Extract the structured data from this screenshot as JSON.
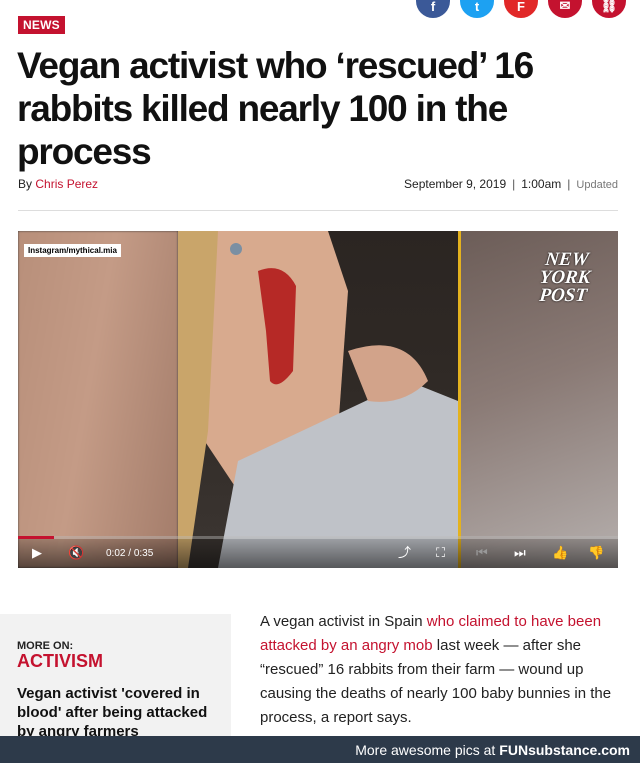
{
  "section_tag": "NEWS",
  "share_icons": [
    {
      "name": "facebook-icon",
      "glyph": "f",
      "color": "#3b5998"
    },
    {
      "name": "twitter-icon",
      "glyph": "t",
      "color": "#1da1f2"
    },
    {
      "name": "flipboard-icon",
      "glyph": "F",
      "color": "#e12828"
    },
    {
      "name": "email-icon",
      "glyph": "✉",
      "color": "#c4122f"
    },
    {
      "name": "link-icon",
      "glyph": "⛓",
      "color": "#c4122f"
    }
  ],
  "headline": "Vegan activist who ‘rescued’ 16 rabbits killed nearly 100 in the process",
  "byline": {
    "prefix": "By",
    "author": "Chris Perez"
  },
  "dateline": {
    "date": "September 9, 2019",
    "time": "1:00am",
    "updated": "Updated"
  },
  "video": {
    "watermark": "Instagram/mythical.mia",
    "logo_lines": [
      "NEW",
      "YORK",
      "POST"
    ],
    "current_time": "0:02",
    "duration": "0:35",
    "progress_pct": 6
  },
  "more_on": {
    "label": "MORE ON:",
    "topic": "ACTIVISM",
    "related_title": "Vegan activist 'covered in blood' after being attacked by angry farmers"
  },
  "article": {
    "p1_start": "A vegan activist in Spain ",
    "p1_link": "who claimed to have been attacked by an angry mob",
    "p1_end": " last week — after she “rescued” 16 rabbits from their farm — wound up causing the deaths of nearly 100 baby bunnies in the process, a report says."
  },
  "footer": {
    "text": "More awesome pics at",
    "brand": "FUNsubstance.com"
  },
  "colors": {
    "accent": "#c4122f",
    "footer_bg": "#2d3a4a"
  }
}
